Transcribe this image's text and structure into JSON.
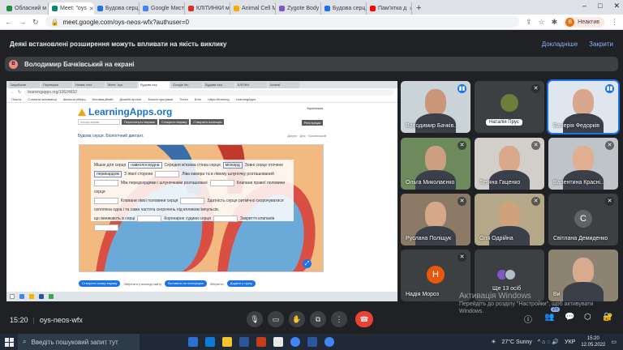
{
  "browser": {
    "tabs": [
      {
        "label": "Обласний м",
        "color": "#1e8e3e"
      },
      {
        "label": "Meet: \"oys",
        "color": "#00897b",
        "active": true
      },
      {
        "label": "Будова серц",
        "color": "#1a73e8"
      },
      {
        "label": "Google Миста",
        "color": "#4285f4"
      },
      {
        "label": "КЛІТИНКИ м",
        "color": "#d93025"
      },
      {
        "label": "Animal Cell Mo",
        "color": "#f9ab00"
      },
      {
        "label": "Zygote Body",
        "color": "#7e57c2"
      },
      {
        "label": "Будова серц",
        "color": "#1a73e8"
      },
      {
        "label": "Пам'ятка д",
        "color": "#ff0000"
      }
    ],
    "url": "meet.google.com/oys-neos-wfx?authuser=0",
    "profile_letter": "В",
    "profile_label": "Неактив"
  },
  "extension_bar": {
    "message": "Деякі встановлені розширення можуть впливати на якість виклику",
    "details": "Докладніше",
    "close": "Закрити"
  },
  "presenting": {
    "avatar_letter": "В",
    "text": "Володимир Бачківський на екрані"
  },
  "shared_screen": {
    "tabs": [
      "Зарубіжне",
      "Перевірка",
      "Назва: test",
      "Meet: 'oys",
      "Будова сер",
      "Google Мс",
      "Будова сер",
      "КЛІТИН",
      "Animal"
    ],
    "url": "learningapps.org/10624832",
    "bookmarks": [
      "Пошта",
      "Сланити вихованці",
      "Шкільна кіберц",
      "Мотиваційний",
      "Дизайн проект",
      "Класні програми",
      "Тести",
      "Блог",
      "https://learning",
      "LearningApps"
    ],
    "logo": "LearningApps.org",
    "language": "Українська",
    "search_placeholder": "пошук вправ",
    "nav": [
      "Переглянути вправи",
      "Створити вправу",
      "Створити колекцію"
    ],
    "register": "Реєстрація",
    "title": "Будова серця. Біологічний диктант.",
    "meta": "Дякую · Дня · Бачківський",
    "exercise_lines": [
      [
        {
          "t": "Мішок для серця"
        },
        {
          "f": "навколосердна"
        },
        {
          "t": "Середня м'язова стінка серця"
        },
        {
          "f": "міокард"
        },
        {
          "t": "Зовні серце оточене"
        }
      ],
      [
        {
          "f": "перикардом"
        },
        {
          "t": "З лівої сторони"
        },
        {
          "b": true
        },
        {
          "t": "Ліва камера та в лівому шлуночку розташований"
        }
      ],
      [
        {
          "b": true
        },
        {
          "t": "Між передсердями і шлуночками розташовані"
        },
        {
          "b": true
        },
        {
          "t": "Клапани правої половини серця"
        }
      ],
      [
        {
          "b": true
        },
        {
          "t": "Клапани лівої половини серця"
        },
        {
          "b": true
        },
        {
          "t": "Здатність серця ритмічно скорочуватися"
        }
      ],
      [
        {
          "t": "охоплена одна і та сама частота скорочень під впливом імпульсів,"
        }
      ],
      [
        {
          "t": "що виникають в серці"
        },
        {
          "b": true
        },
        {
          "t": "Коронарне судини серця"
        },
        {
          "b": true
        },
        {
          "t": "Закриття клапанів"
        }
      ],
      [
        {
          "b": true
        }
      ]
    ],
    "footer": [
      "Створити схожу вправу",
      "Зберігати у вигляді сайту",
      "Вставити на платформі",
      "Зберегти",
      "Додати у групу"
    ]
  },
  "participants": [
    {
      "name": "Володимир Бачків...",
      "mic": "talk",
      "kind": "video",
      "bg": "#c9d3d8",
      "skin": "#c9967a"
    },
    {
      "name": "Наталія Прус",
      "mic": "mute",
      "kind": "photo",
      "bg": "#2c2c2e"
    },
    {
      "name": "Валерія Федорків",
      "mic": "talk",
      "kind": "video",
      "bg": "#dfe6ee",
      "skin": "#d9a88c",
      "highlight": true
    },
    {
      "name": "Ольга Миколаєнко",
      "mic": "mute",
      "kind": "video",
      "bg": "#6d8a5d",
      "skin": "#caa080"
    },
    {
      "name": "Тетяна Гаценко",
      "mic": "mute",
      "kind": "video",
      "bg": "#d2cfca",
      "skin": "#d9a98a"
    },
    {
      "name": "Валентина Красні...",
      "mic": "mute",
      "kind": "video",
      "bg": "#bfc4c8",
      "skin": "#e0ae90"
    },
    {
      "name": "Руслана Поліщук",
      "mic": "mute",
      "kind": "video",
      "bg": "#8a7a66",
      "skin": "#d6a88a"
    },
    {
      "name": "Оля Одрійна",
      "mic": "mute",
      "kind": "video",
      "bg": "#b5a889",
      "skin": "#cfa27c"
    },
    {
      "name": "Світлана Демиденко",
      "mic": "mute",
      "kind": "avatar",
      "letter": "С",
      "color": "#5f6368"
    },
    {
      "name": "Надія Мороз",
      "mic": "mute",
      "kind": "avatar",
      "letter": "Н",
      "color": "#e8590c"
    },
    {
      "name": "Ще 13 осіб",
      "mic": "none",
      "kind": "more"
    },
    {
      "name": "Ви",
      "mic": "none",
      "kind": "video",
      "bg": "#8d8372",
      "skin": "#d9ab8e"
    }
  ],
  "watermark": {
    "title": "Активація Windows",
    "sub1": "Перейдіть до розділу \"Настройки\", щоб активувати",
    "sub2": "Windows."
  },
  "meet": {
    "time": "15:20",
    "code": "oys-neos-wfx",
    "people_count": "25"
  },
  "taskbar": {
    "search": "Введіть пошуковий запит тут",
    "weather": "27°C  Sunny",
    "lang": "УКР",
    "clock_time": "15:20",
    "clock_date": "12.05.2022"
  },
  "colors": {
    "end_call": "#ea4335",
    "accent": "#8ab4f8",
    "active_speaker": "#1a73e8"
  }
}
